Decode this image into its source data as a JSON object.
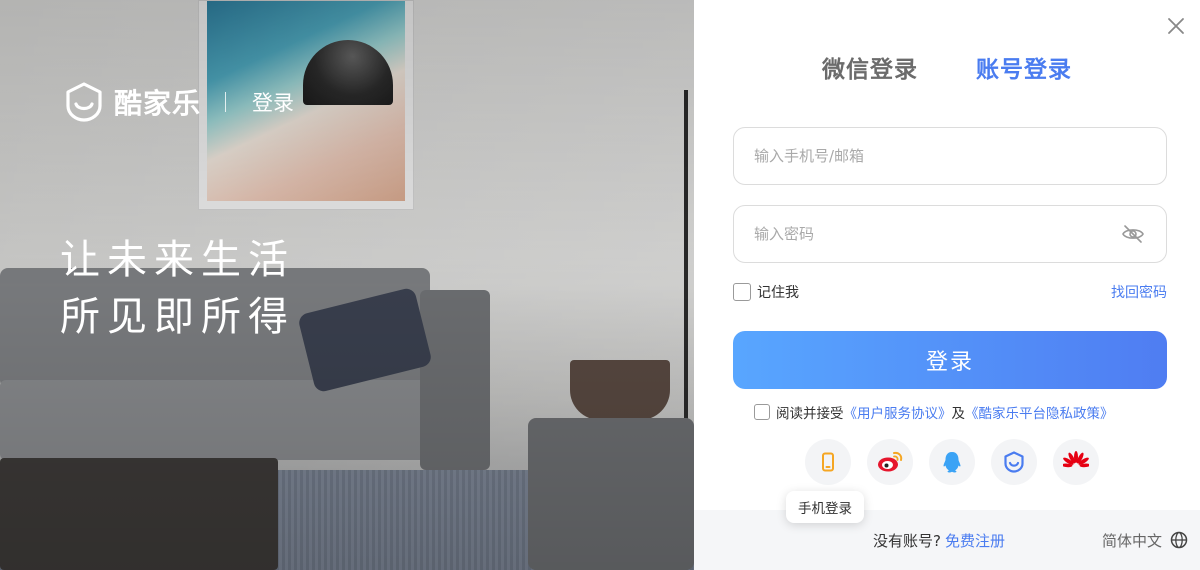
{
  "hero": {
    "brand_name": "酷家乐",
    "page_label": "登录",
    "slogan_line1": "让未来生活",
    "slogan_line2": "所见即所得"
  },
  "login": {
    "tabs": [
      {
        "label": "微信登录",
        "active": false
      },
      {
        "label": "账号登录",
        "active": true
      }
    ],
    "phone_placeholder": "输入手机号/邮箱",
    "password_placeholder": "输入密码",
    "remember_label": "记住我",
    "forgot_label": "找回密码",
    "submit_label": "登录",
    "agree_prefix": "阅读并接受",
    "user_agreement": "《用户服务协议》",
    "and": "及",
    "privacy_policy": "《酷家乐平台隐私政策》",
    "socials": [
      {
        "name": "phone-icon",
        "color": "#f5a623"
      },
      {
        "name": "weibo-icon",
        "color": "#e6162d"
      },
      {
        "name": "qq-icon",
        "color": "#3ba3f5"
      },
      {
        "name": "kujiale-icon",
        "color": "#4a7cf0"
      },
      {
        "name": "huawei-icon",
        "color": "#e60012"
      }
    ],
    "tooltip": "手机登录"
  },
  "footer": {
    "no_account": "没有账号?",
    "register": "免费注册",
    "language": "简体中文"
  },
  "colors": {
    "accent": "#4a7cf0",
    "button_start": "#58a6ff",
    "button_end": "#4f7df2"
  }
}
